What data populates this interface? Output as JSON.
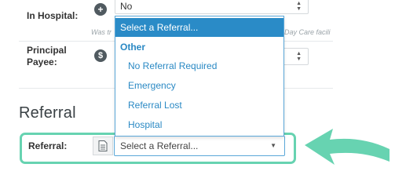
{
  "in_hospital": {
    "label": "In Hospital:",
    "icon": "plus-icon",
    "value": "No",
    "hint_left": "Was tr",
    "hint_right": "Day Care facili"
  },
  "principal_payee": {
    "label_line1": "Principal",
    "label_line2": "Payee:",
    "icon": "dollar-icon"
  },
  "referral_section": {
    "title": "Referral",
    "label": "Referral:",
    "icon": "document-icon",
    "placeholder": "Select a Referral..."
  },
  "dropdown": {
    "selected": "Select a Referral...",
    "group": "Other",
    "options": [
      "No Referral Required",
      "Emergency",
      "Referral Lost",
      "Hospital"
    ]
  },
  "colors": {
    "highlight": "#67d3b1",
    "dropdown_selected_bg": "#2a8bc7",
    "option_text": "#2a89c4"
  }
}
